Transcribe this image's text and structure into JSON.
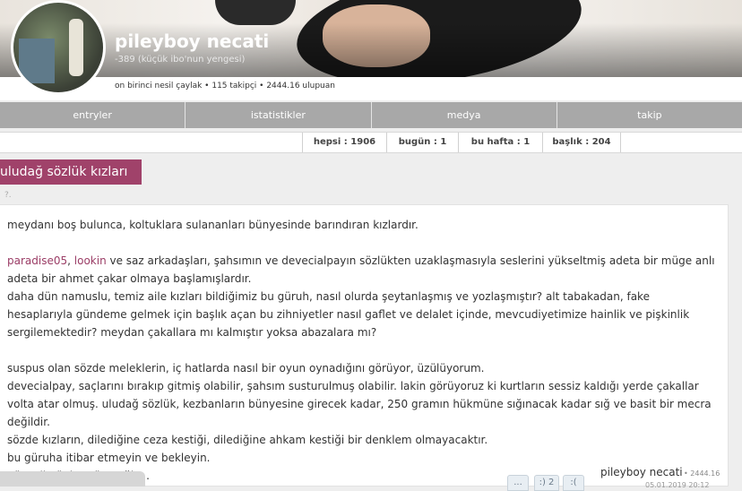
{
  "profile": {
    "username": "pileyboy necati",
    "subtitle": "-389 (küçük ibo'nun yengesi)",
    "stats": "on birinci nesil çaylak • 115 takipçi • 2444.16 ulupuan"
  },
  "tabs": [
    {
      "label": "entryler"
    },
    {
      "label": "istatistikler"
    },
    {
      "label": "medya"
    },
    {
      "label": "takip"
    }
  ],
  "counts": [
    {
      "label": "hepsi : 1906"
    },
    {
      "label": "bugün : 1"
    },
    {
      "label": "bu hafta : 1"
    },
    {
      "label": "başlık : 204"
    }
  ],
  "topic": {
    "title": "uludağ sözlük kızları",
    "marker": "?."
  },
  "entry": {
    "l1": "meydanı boş bulunca, koltuklara sulananları bünyesinde barındıran kızlardır.",
    "link1": "paradise05",
    "sep": ", ",
    "link2": "lookin",
    "l2a": " ve saz arkadaşları, şahsımın ve devecialpayın sözlükten uzaklaşmasıyla seslerini yükseltmiş adeta bir müge anlı adeta bir ahmet çakar olmaya başlamışlardır.",
    "l3": "daha dün namuslu, temiz aile kızları bildiğimiz bu güruh, nasıl olurda şeytanlaşmış ve yozlaşmıştır? alt tabakadan, fake hesaplarıyla gündeme gelmek için başlık açan bu zihniyetler nasıl gaflet ve delalet içinde, mevcudiyetimize hainlik ve pişkinlik sergilemektedir? meydan çakallara mı kalmıştır yoksa abazalara mı?",
    "l4": "suspus olan sözde meleklerin, iç hatlarda nasıl bir oyun oynadığını görüyor, üzülüyorum.",
    "l5": "devecialpay, saçlarını bırakıp gitmiş olabilir, şahsım susturulmuş olabilir. lakin görüyoruz ki kurtların sessiz kaldığı yerde çakallar volta atar olmuş. uludağ sözlük, kezbanların bünyesine girecek kadar, 250 gramın hükmüne sığınacak kadar sığ ve basit bir mecra değildir.",
    "l6": "sözde kızların, dilediğine ceza kestiği, dilediğine ahkam kestiği bir denklem olmayacaktır.",
    "l7": "bu güruha itibar etmeyin ve bekleyin.",
    "l8": "güneşli günler göreceğiz..."
  },
  "footer": {
    "author": "pileyboy necati",
    "score": "• 2444.16",
    "vote1": "...",
    "vote2": ":) 2",
    "vote3": ":(",
    "date": "05.01.2019 20:12"
  }
}
